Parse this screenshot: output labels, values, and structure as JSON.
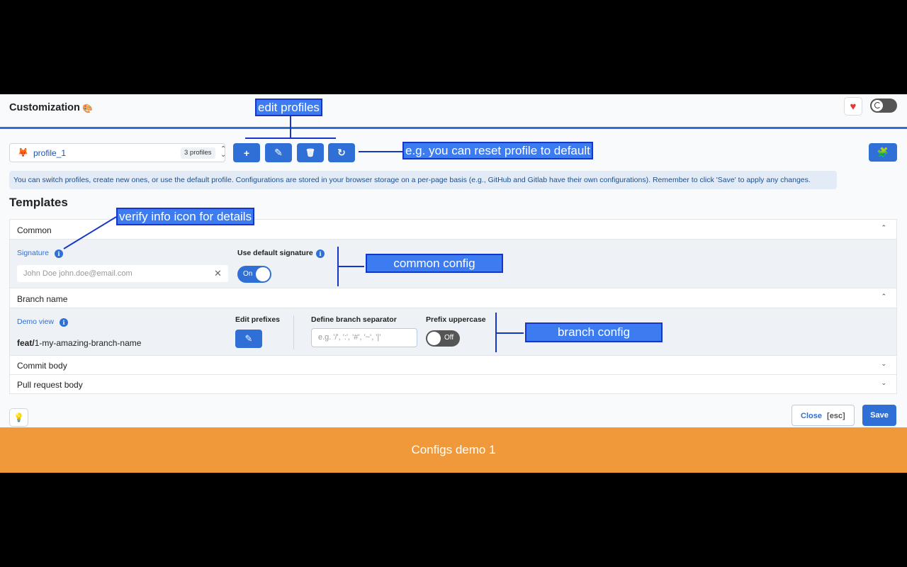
{
  "app": {
    "title": "Customization",
    "title_icon": "🎨"
  },
  "header": {
    "heart_icon": "♥",
    "theme_toggle": "dark-mode-toggle"
  },
  "profile": {
    "icon": "🦊",
    "selected": "profile_1",
    "count_badge": "3 profiles"
  },
  "toolbar": {
    "add_icon": "+",
    "edit_icon": "✎",
    "delete_icon": "🗑",
    "reset_icon": "↻",
    "extension_icon": "🧩"
  },
  "info_banner": "You can switch profiles, create new ones, or use the default profile. Configurations are stored in your browser storage on a per-page basis (e.g., GitHub and Gitlab have their own configurations). Remember to click 'Save' to apply any changes.",
  "templates": {
    "title": "Templates",
    "common": {
      "label": "Common",
      "signature_label": "Signature",
      "signature_placeholder": "John Doe john.doe@email.com",
      "use_default_label": "Use default signature",
      "toggle_label": "On"
    },
    "branch": {
      "label": "Branch name",
      "demo_label": "Demo view",
      "demo_prefix": "feat/",
      "demo_rest": "1-my-amazing-branch-name",
      "edit_prefixes_label": "Edit prefixes",
      "separator_label": "Define branch separator",
      "separator_placeholder": "e.g. '/', ':', '#', '~', '|'",
      "uppercase_label": "Prefix uppercase",
      "toggle_label": "Off"
    },
    "commit_body": "Commit body",
    "pr_body": "Pull request body"
  },
  "footer_buttons": {
    "close": "Close",
    "esc": "[esc]",
    "save": "Save"
  },
  "annotations": {
    "edit_profiles": "edit profiles",
    "reset": "e.g. you can reset profile to default",
    "info_icon": "verify info icon for details",
    "common_config": "common config",
    "branch_config": "branch config"
  },
  "caption": "Configs demo 1",
  "colors": {
    "accent": "#2f6fd6",
    "callout": "#3d7cf0",
    "caption_bar": "#f0993a"
  }
}
